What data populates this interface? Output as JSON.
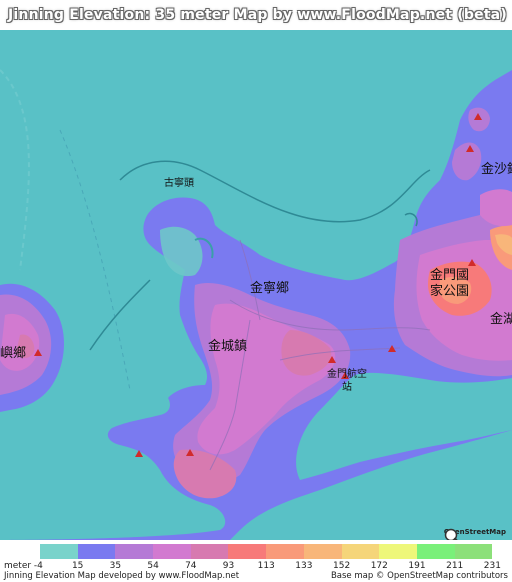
{
  "header": {
    "title": "Jinning Elevation: 35 meter Map by www.FloodMap.net (beta)"
  },
  "map": {
    "water_color": "#59c1c6",
    "labels": {
      "gu_ning_tou": "古寧頭",
      "jin_sha": "金沙鎮",
      "jin_ning": "金寧鄉",
      "jin_men_park": "金門國家公園",
      "jin_cheng": "金城鎮",
      "jin_hu": "金湖",
      "airport": "金門航空站",
      "lieyu": "嶼鄉"
    },
    "osm_logo_text": "OpenStreetMap"
  },
  "legend": {
    "unit_label": "meter -4",
    "ticks": [
      "15",
      "35",
      "54",
      "74",
      "93",
      "113",
      "133",
      "152",
      "172",
      "191",
      "211",
      "231"
    ],
    "colors": [
      "#79d3cb",
      "#7a7af0",
      "#b57ad6",
      "#d27ad0",
      "#d77ab0",
      "#f77a7a",
      "#f99a7a",
      "#f8b67a",
      "#f5d57a",
      "#eef77a",
      "#7af07a",
      "#8ce07a"
    ]
  },
  "footer": {
    "left": "Jinning Elevation Map developed by www.FloodMap.net",
    "right": "Base map © OpenStreetMap contributors"
  }
}
